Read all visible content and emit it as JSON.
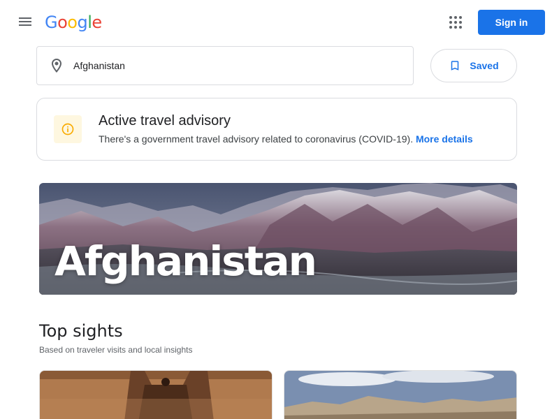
{
  "header": {
    "logo_letters": [
      {
        "char": "G",
        "color": "#4285F4"
      },
      {
        "char": "o",
        "color": "#EA4335"
      },
      {
        "char": "o",
        "color": "#FBBC05"
      },
      {
        "char": "g",
        "color": "#4285F4"
      },
      {
        "char": "l",
        "color": "#34A853"
      },
      {
        "char": "e",
        "color": "#EA4335"
      }
    ],
    "menu_icon": "hamburger-menu-icon",
    "apps_icon": "apps-grid-icon",
    "signin_label": "Sign in"
  },
  "search": {
    "value": "Afghanistan",
    "icon": "location-pin-icon"
  },
  "saved": {
    "label": "Saved",
    "icon": "bookmark-icon"
  },
  "advisory": {
    "icon": "info-icon",
    "title": "Active travel advisory",
    "text": "There's a government travel advisory related to coronavirus (COVID-19).",
    "link": "More details"
  },
  "hero": {
    "title": "Afghanistan"
  },
  "top_sights": {
    "title": "Top sights",
    "subtitle": "Based on traveler visits and local insights"
  },
  "colors": {
    "accent": "#1a73e8",
    "advisory_bg": "#fef7e0",
    "advisory_icon": "#f9ab00"
  }
}
